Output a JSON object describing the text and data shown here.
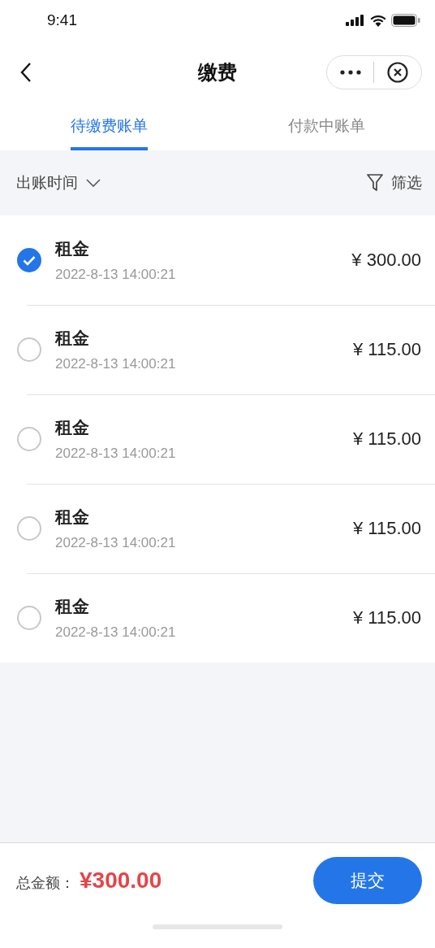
{
  "status_bar": {
    "time": "9:41"
  },
  "nav": {
    "title": "缴费"
  },
  "tabs": [
    {
      "label": "待缴费账单",
      "selected": true
    },
    {
      "label": "付款中账单",
      "selected": false
    }
  ],
  "filter_bar": {
    "sort_label": "出账时间",
    "filter_label": "筛选"
  },
  "bills": [
    {
      "name": "租金",
      "time": "2022-8-13 14:00:21",
      "amount": "¥ 300.00",
      "selected": true
    },
    {
      "name": "租金",
      "time": "2022-8-13 14:00:21",
      "amount": "¥ 115.00",
      "selected": false
    },
    {
      "name": "租金",
      "time": "2022-8-13 14:00:21",
      "amount": "¥ 115.00",
      "selected": false
    },
    {
      "name": "租金",
      "time": "2022-8-13 14:00:21",
      "amount": "¥ 115.00",
      "selected": false
    },
    {
      "name": "租金",
      "time": "2022-8-13 14:00:21",
      "amount": "¥ 115.00",
      "selected": false
    }
  ],
  "footer": {
    "total_label": "总金额：",
    "total": "¥300.00",
    "submit": "提交"
  }
}
